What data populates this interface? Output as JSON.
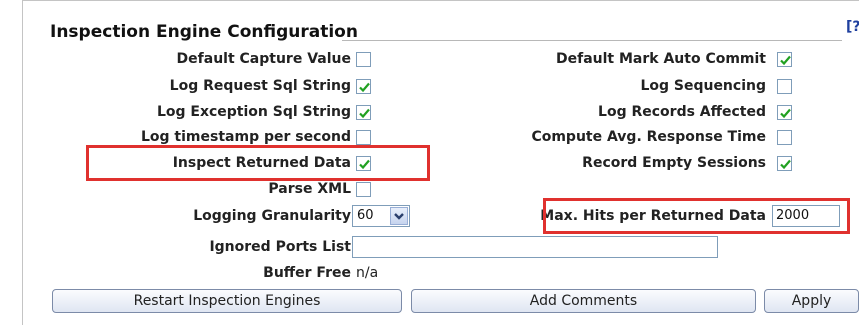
{
  "title": "Inspection Engine Configuration",
  "help_icon": "help-icon",
  "left_fields": [
    {
      "label": "Default Capture Value",
      "checked": false
    },
    {
      "label": "Log Request Sql String",
      "checked": true
    },
    {
      "label": "Log Exception Sql String",
      "checked": true
    },
    {
      "label": "Log timestamp per second",
      "checked": false
    },
    {
      "label": "Inspect Returned Data",
      "checked": true
    },
    {
      "label": "Parse XML",
      "checked": false
    }
  ],
  "right_fields": [
    {
      "label": "Default Mark Auto Commit",
      "checked": true
    },
    {
      "label": "Log Sequencing",
      "checked": false
    },
    {
      "label": "Log Records Affected",
      "checked": true
    },
    {
      "label": "Compute Avg. Response Time",
      "checked": false
    },
    {
      "label": "Record Empty Sessions",
      "checked": true
    }
  ],
  "logging_granularity": {
    "label": "Logging Granularity",
    "value": "60"
  },
  "max_hits": {
    "label": "Max. Hits per Returned Data",
    "value": "2000"
  },
  "ignored_ports": {
    "label": "Ignored Ports List",
    "value": ""
  },
  "buffer_free": {
    "label": "Buffer Free",
    "value": "n/a"
  },
  "buttons": {
    "restart": "Restart Inspection Engines",
    "add_comments": "Add Comments",
    "apply": "Apply"
  },
  "colors": {
    "highlight": "#e0312e",
    "checkmark": "#21a121"
  }
}
